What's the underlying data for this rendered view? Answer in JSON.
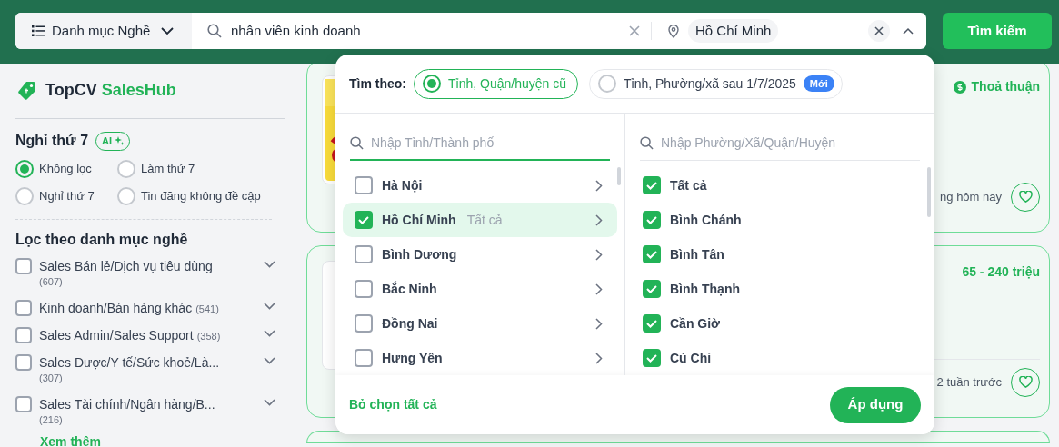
{
  "header": {
    "category_button": "Danh mục Nghề",
    "keyword": "nhân viên kinh doanh",
    "location_chip": "Hồ Chí Minh",
    "search_button": "Tìm kiếm"
  },
  "sidebar": {
    "brand": "TopCV",
    "brand_accent": "SalesHub",
    "saturday_filter": {
      "title": "Nghỉ thứ 7",
      "badge": "AI",
      "options": [
        {
          "label": "Không lọc",
          "selected": true
        },
        {
          "label": "Làm thứ 7",
          "selected": false
        },
        {
          "label": "Nghỉ thứ 7",
          "selected": false
        },
        {
          "label": "Tin đăng không đề cập",
          "selected": false
        }
      ]
    },
    "category_filter": {
      "title": "Lọc theo danh mục nghề",
      "items": [
        {
          "label": "Sales Bán lẻ/Dịch vụ tiêu dùng",
          "count": "(607)",
          "checked": false,
          "wrap": true
        },
        {
          "label": "Kinh doanh/Bán hàng khác",
          "count": "(541)",
          "checked": false,
          "wrap": false
        },
        {
          "label": "Sales Admin/Sales Support",
          "count": "(358)",
          "checked": false,
          "wrap": false
        },
        {
          "label": "Sales Dược/Y tế/Sức khoẻ/Là...",
          "count": "(307)",
          "checked": false,
          "wrap": true
        },
        {
          "label": "Sales Tài chính/Ngân hàng/B...",
          "count": "(216)",
          "checked": false,
          "wrap": true
        }
      ],
      "more": "Xem thêm"
    }
  },
  "jobs": [
    {
      "salary": "Thoả thuận",
      "salary_icon": true,
      "posted": "ng hôm nay"
    },
    {
      "salary": "65 - 240 triệu",
      "salary_icon": false,
      "posted": "2 tuần trước"
    }
  ],
  "location_dropdown": {
    "search_by_label": "Tìm theo:",
    "modes": [
      {
        "label": "Tỉnh, Quận/huyện cũ",
        "selected": true
      },
      {
        "label": "Tỉnh, Phường/xã sau 1/7/2025",
        "badge": "Mới",
        "selected": false
      }
    ],
    "province_search": {
      "placeholder": "Nhập Tỉnh/Thành phố"
    },
    "provinces": [
      {
        "name": "Hà Nội",
        "checked": false,
        "selected": false
      },
      {
        "name": "Hồ Chí Minh",
        "note": "Tất cả",
        "checked": true,
        "selected": true
      },
      {
        "name": "Bình Dương",
        "checked": false,
        "selected": false
      },
      {
        "name": "Bắc Ninh",
        "checked": false,
        "selected": false
      },
      {
        "name": "Đồng Nai",
        "checked": false,
        "selected": false
      },
      {
        "name": "Hưng Yên",
        "checked": false,
        "selected": false
      }
    ],
    "district_search": {
      "placeholder": "Nhập Phường/Xã/Quận/Huyện"
    },
    "districts": [
      {
        "name": "Tất cả",
        "checked": true
      },
      {
        "name": "Bình Chánh",
        "checked": true
      },
      {
        "name": "Bình Tân",
        "checked": true
      },
      {
        "name": "Bình Thạnh",
        "checked": true
      },
      {
        "name": "Cần Giờ",
        "checked": true
      },
      {
        "name": "Củ Chi",
        "checked": true
      }
    ],
    "clear_all": "Bỏ chọn tất cả",
    "apply": "Áp dụng"
  }
}
